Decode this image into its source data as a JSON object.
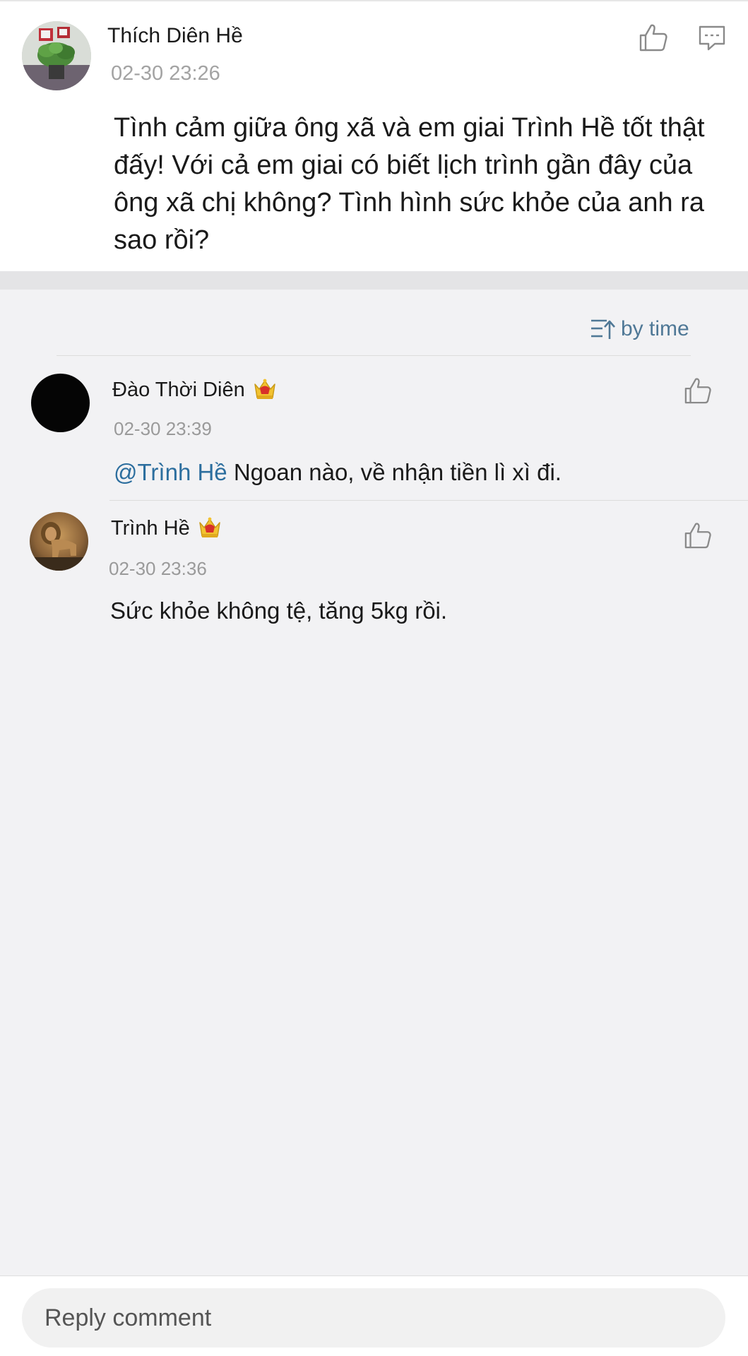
{
  "post": {
    "author": "Thích Diên Hề",
    "time": "02-30 23:26",
    "body": "Tình cảm giữa ông xã và em giai Trình Hề tốt thật đấy! Với cả em giai có biết lịch trình gần đây của ông xã chị không? Tình hình sức khỏe của anh ra sao rồi?",
    "icons": [
      "thumbs-up-icon",
      "comment-icon"
    ]
  },
  "sort": {
    "label": "by time",
    "icon": "sort-ascending-icon"
  },
  "comments": [
    {
      "author": "Đào Thời Diên",
      "badge": "crown-icon",
      "time": "02-30 23:39",
      "mention": "@Trình Hề",
      "text": " Ngoan nào, về nhận tiền lì xì đi."
    },
    {
      "author": "Trình Hề",
      "badge": "crown-icon",
      "time": "02-30 23:36",
      "text": "Sức khỏe không tệ, tăng 5kg rồi."
    }
  ],
  "reply": {
    "placeholder": "Reply comment"
  },
  "colors": {
    "accent": "#4f7896",
    "mention": "#2c6e9e",
    "background": "#f2f2f4",
    "crown_gold": "#f2c230",
    "crown_red": "#d8302a"
  }
}
